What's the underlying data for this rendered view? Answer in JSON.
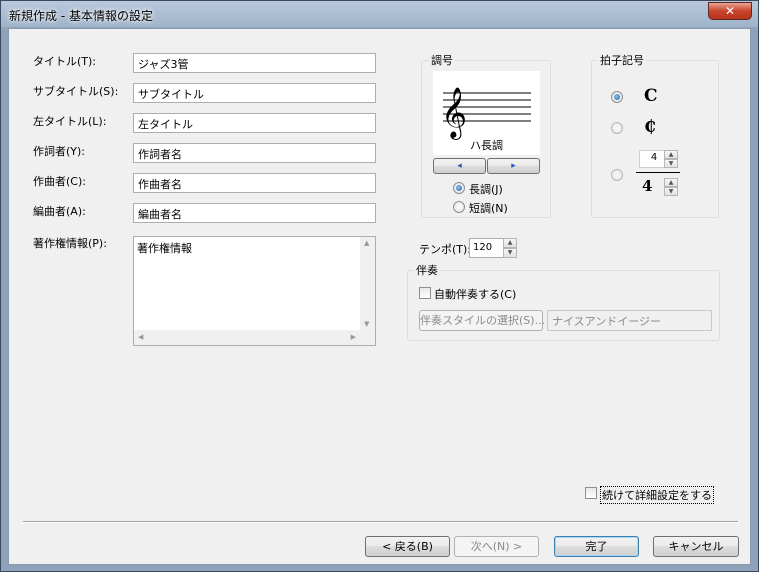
{
  "window": {
    "title": "新規作成 - 基本情報の設定",
    "close_symbol": "✕"
  },
  "fields": {
    "title_label": "タイトル(T):",
    "title_value": "ジャズ3管",
    "subtitle_label": "サブタイトル(S):",
    "subtitle_value": "サブタイトル",
    "left_title_label": "左タイトル(L):",
    "left_title_value": "左タイトル",
    "lyricist_label": "作詞者(Y):",
    "lyricist_value": "作詞者名",
    "composer_label": "作曲者(C):",
    "composer_value": "作曲者名",
    "arranger_label": "編曲者(A):",
    "arranger_value": "編曲者名",
    "copyright_label": "著作権情報(P):",
    "copyright_value": "著作権情報"
  },
  "key": {
    "group_title": "調号",
    "key_name": "ハ長調",
    "major_label": "長調(J)",
    "minor_label": "短調(N)",
    "selected_mode": "major",
    "prev_symbol": "◂",
    "next_symbol": "▸"
  },
  "time_signature": {
    "group_title": "拍子記号",
    "common_symbol": "C",
    "cut_symbol": "₵",
    "numerator": "4",
    "denominator": "4",
    "selected": "common"
  },
  "tempo": {
    "label": "テンポ(T):",
    "value": "120"
  },
  "accompaniment": {
    "group_title": "伴奏",
    "auto_label": "自動伴奏する(C)",
    "auto_checked": false,
    "style_button": "伴奏スタイルの選択(S)...",
    "style_name": "ナイスアンドイージー"
  },
  "continue_detail_label": "続けて詳細設定をする",
  "buttons": {
    "back": "< 戻る(B)",
    "next": "次へ(N) >",
    "finish": "完了",
    "cancel": "キャンセル"
  },
  "colors": {
    "title_bar": "#9fb3c9",
    "close_button": "#c8452b",
    "client_bg": "#f0f0f0",
    "radio_selected": "#1c5db5"
  }
}
